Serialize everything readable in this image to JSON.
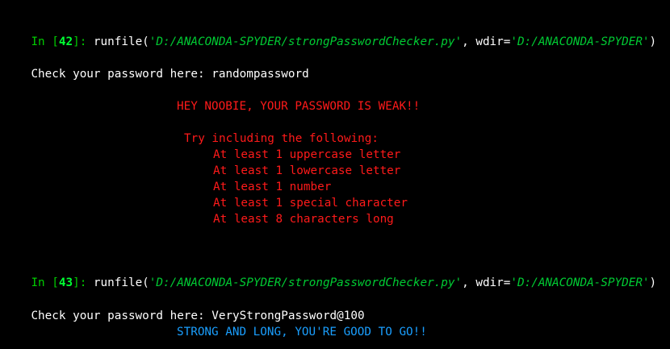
{
  "colors": {
    "background": "#000000",
    "prompt_green": "#00cc00",
    "string_green": "#00cc33",
    "warning_red": "#ff1a1a",
    "success_blue": "#1a9fff",
    "text_white": "#ffffff"
  },
  "cells": [
    {
      "prompt_in": "In [",
      "prompt_number": "42",
      "prompt_close": "]:",
      "call_name": " runfile(",
      "arg1": "'D:/ANACONDA-SPYDER/strongPasswordChecker.py'",
      "separator": ", wdir=",
      "arg2": "'D:/ANACONDA-SPYDER'",
      "call_close": ")",
      "input_prompt": "Check your password here: ",
      "input_value": "randompassword"
    },
    {
      "prompt_in": "In [",
      "prompt_number": "43",
      "prompt_close": "]:",
      "call_name": " runfile(",
      "arg1": "'D:/ANACONDA-SPYDER/strongPasswordChecker.py'",
      "separator": ", wdir=",
      "arg2": "'D:/ANACONDA-SPYDER'",
      "call_close": ")",
      "input_prompt": "Check your password here: ",
      "input_value": "VeryStrongPassword@100"
    }
  ],
  "weak_output": {
    "headline": "HEY NOOBIE, YOUR PASSWORD IS WEAK!!",
    "suggest": "Try including the following:",
    "tips": [
      "At least 1 uppercase letter",
      "At least 1 lowercase letter",
      "At least 1 number",
      "At least 1 special character",
      "At least 8 characters long"
    ]
  },
  "strong_output": {
    "message": "STRONG AND LONG, YOU'RE GOOD TO GO!!"
  }
}
